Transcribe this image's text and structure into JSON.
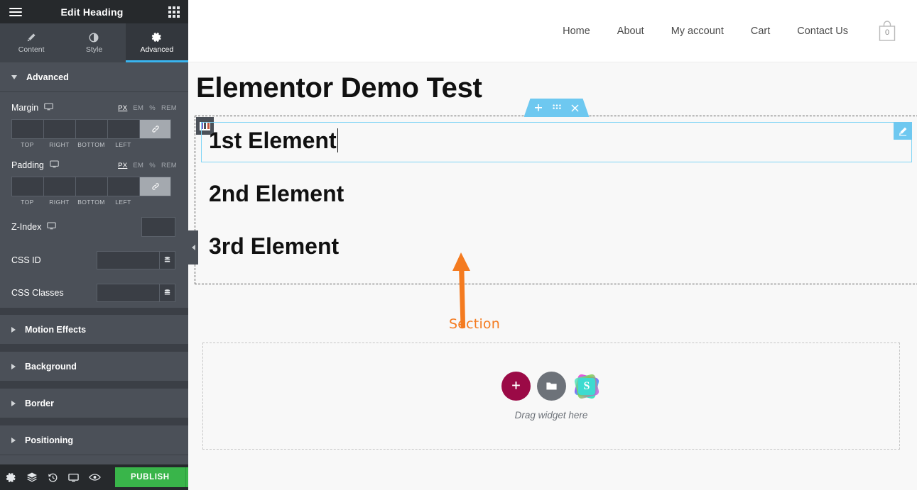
{
  "panel": {
    "header": {
      "title": "Edit Heading",
      "menu_icon": "hamburger-icon",
      "grid_icon": "widgets-grid-icon"
    },
    "tabs": [
      {
        "label": "Content",
        "icon": "pencil-icon",
        "active": false
      },
      {
        "label": "Style",
        "icon": "half-circle-icon",
        "active": false
      },
      {
        "label": "Advanced",
        "icon": "gear-icon",
        "active": true
      }
    ],
    "sections": [
      {
        "label": "Advanced",
        "expanded": true
      },
      {
        "label": "Motion Effects",
        "expanded": false
      },
      {
        "label": "Background",
        "expanded": false
      },
      {
        "label": "Border",
        "expanded": false
      },
      {
        "label": "Positioning",
        "expanded": false
      }
    ],
    "margin": {
      "label": "Margin",
      "device_icon": "desktop-icon",
      "units": [
        "PX",
        "EM",
        "%",
        "REM"
      ],
      "active_unit": "PX",
      "values": {
        "top": "",
        "right": "",
        "bottom": "",
        "left": ""
      },
      "placeholder": "",
      "sides": [
        "TOP",
        "RIGHT",
        "BOTTOM",
        "LEFT"
      ],
      "link_icon": "link-icon"
    },
    "padding": {
      "label": "Padding",
      "device_icon": "desktop-icon",
      "units": [
        "PX",
        "EM",
        "%",
        "REM"
      ],
      "active_unit": "PX",
      "values": {
        "top": "",
        "right": "",
        "bottom": "",
        "left": ""
      },
      "placeholder": "",
      "sides": [
        "TOP",
        "RIGHT",
        "BOTTOM",
        "LEFT"
      ],
      "link_icon": "link-icon"
    },
    "z_index": {
      "label": "Z-Index",
      "device_icon": "desktop-icon",
      "value": "",
      "placeholder": ""
    },
    "css_id": {
      "label": "CSS ID",
      "value": "",
      "placeholder": "",
      "dynamic_icon": "database-icon"
    },
    "css_classes": {
      "label": "CSS Classes",
      "value": "",
      "placeholder": "",
      "dynamic_icon": "database-icon"
    },
    "footer": {
      "icons": [
        "gear-icon",
        "layers-icon",
        "history-icon",
        "responsive-icon",
        "preview-eye-icon"
      ],
      "publish_label": "PUBLISH",
      "publish_color": "#39b54a",
      "publish_arrow_icon": "chevron-up-icon"
    }
  },
  "canvas": {
    "nav": [
      {
        "label": "Home"
      },
      {
        "label": "About"
      },
      {
        "label": "My account"
      },
      {
        "label": "Cart"
      },
      {
        "label": "Contact Us"
      }
    ],
    "cart": {
      "icon": "shopping-bag-icon",
      "count": "0"
    },
    "page_title": "Elementor Demo Test",
    "section": {
      "toolbar": {
        "add_icon": "plus-icon",
        "drag_icon": "dots-grid-icon",
        "close_icon": "close-icon",
        "color": "#6ec8f0"
      },
      "column_handle_icon": "columns-icon",
      "headings": [
        {
          "text": "1st Element",
          "selected": true,
          "editing": true
        },
        {
          "text": "2nd Element",
          "selected": false,
          "editing": false
        },
        {
          "text": "3rd Element",
          "selected": false,
          "editing": false
        }
      ],
      "edit_icon": "pencil-icon"
    },
    "annotation": {
      "label": "Section",
      "color": "#f47b20",
      "arrow": "up-arrow"
    },
    "drop_area": {
      "text": "Drag widget here",
      "add_button_icon": "plus-icon",
      "add_button_color": "#9b0a46",
      "template_button_icon": "folder-icon",
      "library_button_icon": "s-logo-icon",
      "library_letter": "S"
    },
    "collapse_tab_icon": "chevron-left-icon"
  }
}
